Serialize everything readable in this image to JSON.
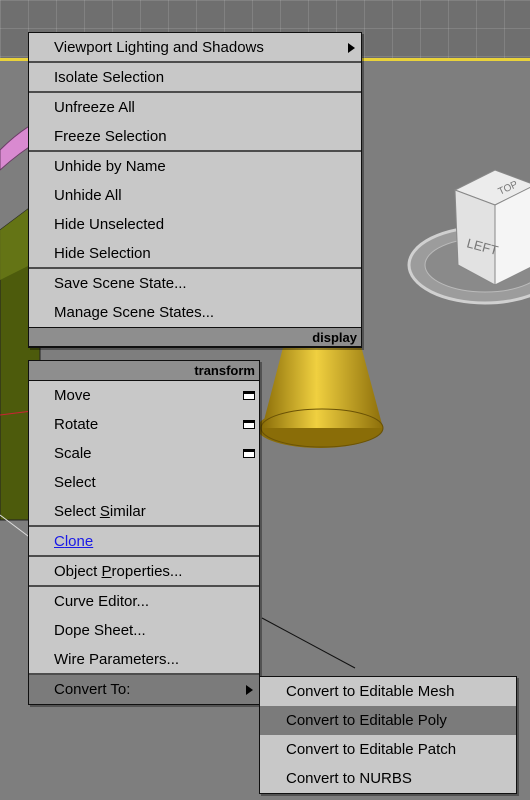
{
  "display_menu": {
    "items": [
      {
        "label": "Viewport Lighting and Shadows",
        "submenu": true,
        "sep": true
      },
      {
        "label": "Isolate Selection",
        "sep": true
      },
      {
        "label": "Unfreeze All"
      },
      {
        "label": "Freeze Selection",
        "sep": true
      },
      {
        "label": "Unhide by Name"
      },
      {
        "label": "Unhide All"
      },
      {
        "label": "Hide Unselected"
      },
      {
        "label": "Hide Selection",
        "sep": true
      },
      {
        "label": "Save Scene State..."
      },
      {
        "label": "Manage Scene States..."
      }
    ],
    "section_label": "display"
  },
  "transform_menu": {
    "section_label": "transform",
    "items": [
      {
        "label": "Move",
        "options_box": true
      },
      {
        "label": "Rotate",
        "options_box": true
      },
      {
        "label": "Scale",
        "options_box": true
      },
      {
        "label": "Select"
      },
      {
        "label_pre": "Select ",
        "label_u": "S",
        "label_post": "imilar",
        "sep": true
      },
      {
        "label_u": "C",
        "label_post": "lone",
        "link": true,
        "sep": true
      },
      {
        "label_pre": "Object ",
        "label_u": "P",
        "label_post": "roperties...",
        "sep": true
      },
      {
        "label": "Curve Editor..."
      },
      {
        "label": "Dope Sheet..."
      },
      {
        "label": "Wire Parameters...",
        "sep": true
      },
      {
        "label": "Convert To:",
        "submenu": true,
        "active": true
      }
    ]
  },
  "convert_submenu": {
    "items": [
      {
        "label": "Convert to Editable Mesh"
      },
      {
        "label": "Convert to Editable Poly",
        "active": true
      },
      {
        "label": "Convert to Editable Patch"
      },
      {
        "label": "Convert to NURBS"
      }
    ]
  },
  "viewcube": {
    "faces": [
      "TOP",
      "LEFT"
    ]
  },
  "colors": {
    "menu_bg": "#c8c8c8",
    "highlight": "#7b7b7b",
    "header_bg": "#8e8e8e",
    "cone": "#d4b21f",
    "box": "#5a6b12",
    "torus": "#d98ad0",
    "grid_line": "#e9d23a"
  }
}
